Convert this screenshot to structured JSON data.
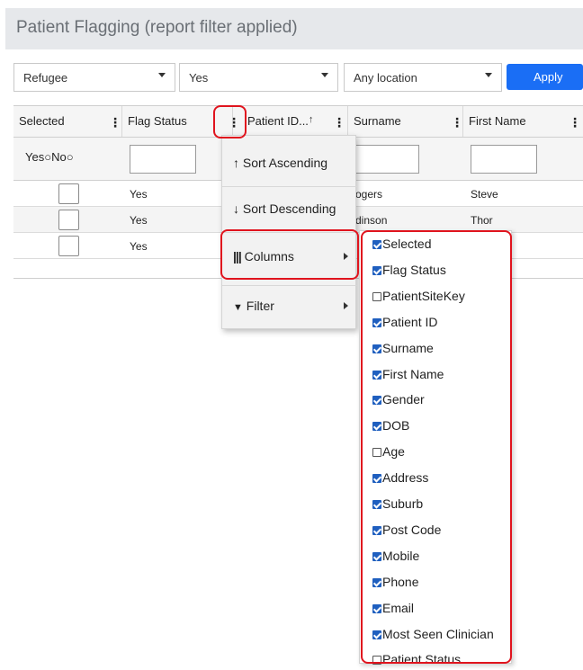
{
  "title": "Patient Flagging (report filter applied)",
  "filters": {
    "flag": "Refugee",
    "value": "Yes",
    "location": "Any location",
    "apply_label": "Apply"
  },
  "grid": {
    "headers": [
      "Selected",
      "Flag Status",
      "Patient ID...",
      "Surname",
      "First Name"
    ],
    "sort_glyph": "↑",
    "selected_filter": {
      "yes": "Yes",
      "no": "No"
    },
    "rows": [
      {
        "flag_status": "Yes",
        "surname": "ogers",
        "first_name": "Steve"
      },
      {
        "flag_status": "Yes",
        "surname": "dinson",
        "first_name": "Thor"
      },
      {
        "flag_status": "Yes",
        "surname": "",
        "first_name": ""
      }
    ]
  },
  "column_menu": {
    "sort_asc": "↑ Sort Ascending",
    "sort_desc": "↓ Sort Descending",
    "columns": "Columns",
    "filter": "Filter",
    "columns_icon": "columns-icon",
    "filter_icon": "funnel-icon"
  },
  "columns_panel": [
    {
      "label": "Selected",
      "checked": true
    },
    {
      "label": "Flag Status",
      "checked": true
    },
    {
      "label": "PatientSiteKey",
      "checked": false
    },
    {
      "label": "Patient ID",
      "checked": true
    },
    {
      "label": "Surname",
      "checked": true
    },
    {
      "label": "First Name",
      "checked": true
    },
    {
      "label": "Gender",
      "checked": true
    },
    {
      "label": "DOB",
      "checked": true
    },
    {
      "label": "Age",
      "checked": false
    },
    {
      "label": "Address",
      "checked": true
    },
    {
      "label": "Suburb",
      "checked": true
    },
    {
      "label": "Post Code",
      "checked": true
    },
    {
      "label": "Mobile",
      "checked": true
    },
    {
      "label": "Phone",
      "checked": true
    },
    {
      "label": "Email",
      "checked": true
    },
    {
      "label": "Most Seen Clinician",
      "checked": true
    },
    {
      "label": "Patient Status",
      "checked": false
    }
  ],
  "colors": {
    "accent": "#1a6ef5",
    "highlight": "#e0141e"
  }
}
